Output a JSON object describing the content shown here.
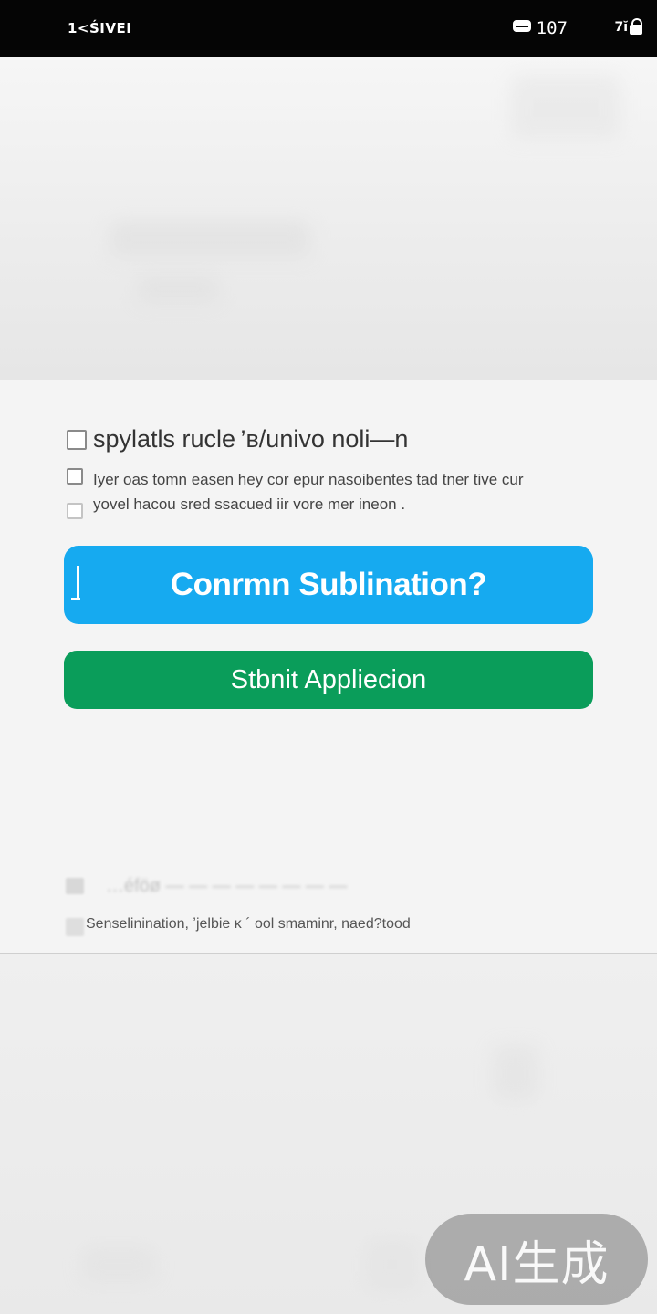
{
  "status_bar": {
    "carrier": "1<ŚIVEI",
    "time": "107",
    "signal": "7ĭ",
    "icons": [
      "battery-icon",
      "lock-icon"
    ]
  },
  "dialog": {
    "option": {
      "title": "spylatls rucle ’в/univo nolі—n",
      "description_line1": "Iyer oas tomn easen hey cor epur nasoibentes tad tner tive cur",
      "description_line2": "yovel hacou sred ssacued iir vore mer ineon ."
    },
    "confirm_button": {
      "label": "Conrmn Sublination?",
      "color": "#16aaf0"
    },
    "submit_button": {
      "label": "Stbnit Appliecion",
      "color": "#0a9d5a"
    },
    "faded_row_text": "…éföø  — — — — — — — —",
    "footer_note": "Senselinination, ʼjelbie κ ´ ool smaminr, naed?tood"
  },
  "watermark": {
    "text": "AI生成"
  }
}
